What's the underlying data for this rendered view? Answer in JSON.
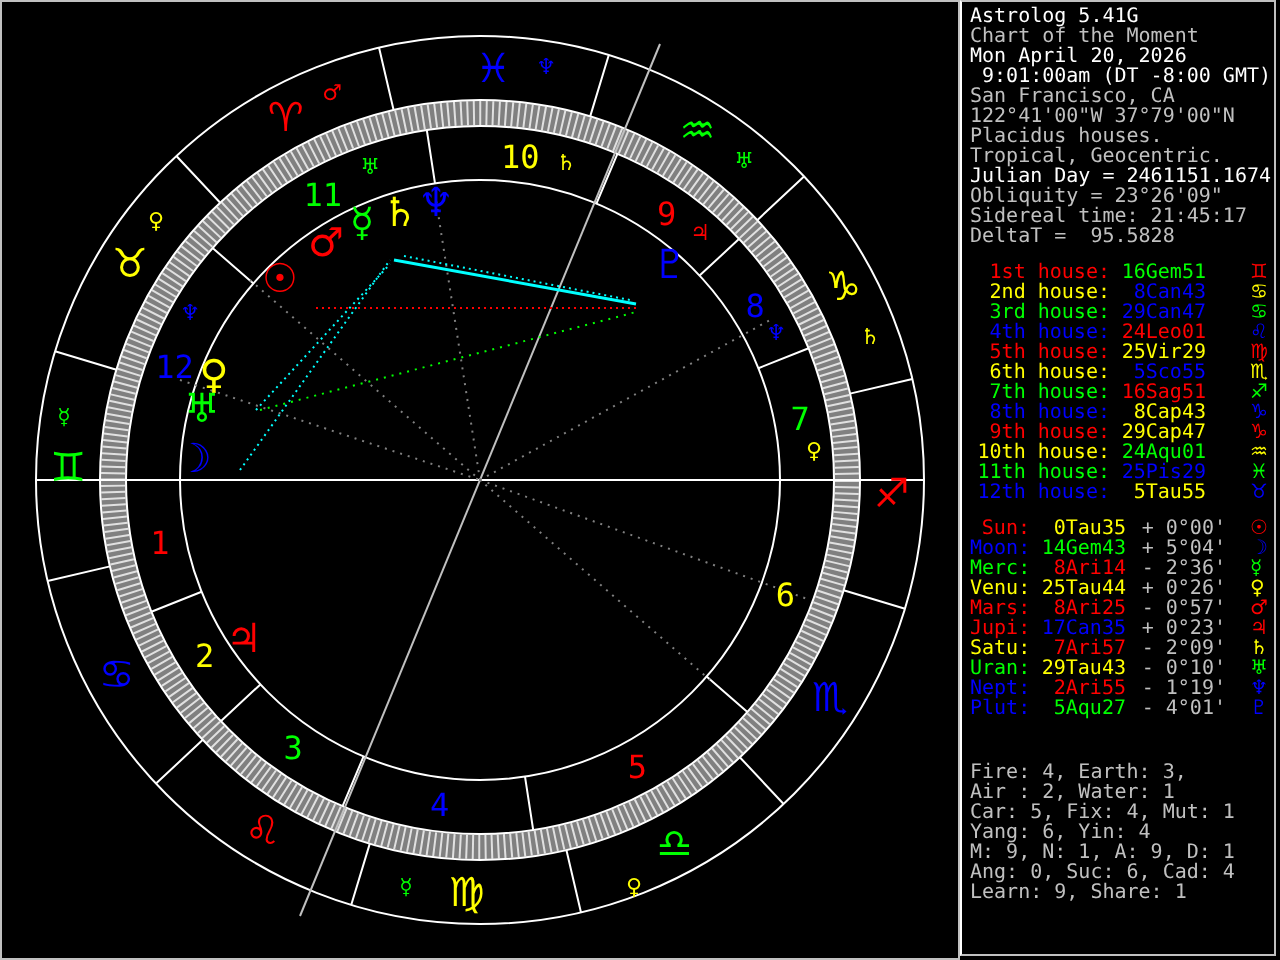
{
  "header": [
    {
      "text": "Astrolog 5.41G",
      "color": "#ffffff"
    },
    {
      "text": "Chart of the Moment",
      "color": "#c0c0c0"
    },
    {
      "text": "Mon April 20, 2026",
      "color": "#ffffff"
    },
    {
      "text": " 9:01:00am (DT -8:00 GMT)",
      "color": "#ffffff"
    },
    {
      "text": "San Francisco, CA",
      "color": "#c0c0c0"
    },
    {
      "text": "122°41'00\"W 37°79'00\"N",
      "color": "#c0c0c0"
    },
    {
      "text": "Placidus houses.",
      "color": "#c0c0c0"
    },
    {
      "text": "Tropical, Geocentric.",
      "color": "#c0c0c0"
    },
    {
      "text": "Julian Day = 2461151.1674",
      "color": "#ffffff"
    },
    {
      "text": "Obliquity = 23°26'09\"",
      "color": "#c0c0c0"
    },
    {
      "text": "Sidereal time: 21:45:17",
      "color": "#c0c0c0"
    },
    {
      "text": "DeltaT =  95.5828",
      "color": "#c0c0c0"
    }
  ],
  "houses": [
    {
      "label": "1st house:",
      "glyph": "♊",
      "color": "#ff0000",
      "position": {
        "text": "16Gem51",
        "color": "#00ff00"
      }
    },
    {
      "label": "2nd house:",
      "glyph": "♋",
      "color": "#ffff00",
      "position": {
        "text": "8Can43",
        "color": "#0000ff"
      }
    },
    {
      "label": "3rd house:",
      "glyph": "♋",
      "color": "#00ff00",
      "position": {
        "text": "29Can47",
        "color": "#0000ff"
      }
    },
    {
      "label": "4th house:",
      "glyph": "♌",
      "color": "#0000ff",
      "position": {
        "text": "24Leo01",
        "color": "#ff0000"
      }
    },
    {
      "label": "5th house:",
      "glyph": "♍",
      "color": "#ff0000",
      "position": {
        "text": "25Vir29",
        "color": "#ffff00"
      }
    },
    {
      "label": "6th house:",
      "glyph": "♏",
      "color": "#ffff00",
      "position": {
        "text": "5Sco55",
        "color": "#0000ff"
      }
    },
    {
      "label": "7th house:",
      "glyph": "♐",
      "color": "#00ff00",
      "position": {
        "text": "16Sag51",
        "color": "#ff0000"
      }
    },
    {
      "label": "8th house:",
      "glyph": "♑",
      "color": "#0000ff",
      "position": {
        "text": "8Cap43",
        "color": "#ffff00"
      }
    },
    {
      "label": "9th house:",
      "glyph": "♑",
      "color": "#ff0000",
      "position": {
        "text": "29Cap47",
        "color": "#ffff00"
      }
    },
    {
      "label": "10th house:",
      "glyph": "♒",
      "color": "#ffff00",
      "position": {
        "text": "24Aqu01",
        "color": "#00ff00"
      }
    },
    {
      "label": "11th house:",
      "glyph": "♓",
      "color": "#00ff00",
      "position": {
        "text": "25Pis29",
        "color": "#0000ff"
      }
    },
    {
      "label": "12th house:",
      "glyph": "♉",
      "color": "#0000ff",
      "position": {
        "text": "5Tau55",
        "color": "#ffff00"
      }
    }
  ],
  "planets": [
    {
      "name": "Sun:",
      "latitude": "+ 0°00'",
      "glyph": "☉",
      "color": "#ff0000",
      "position": {
        "text": "0Tau35",
        "color": "#ffff00"
      }
    },
    {
      "name": "Moon:",
      "latitude": "+ 5°04'",
      "glyph": "☽",
      "color": "#0000ff",
      "position": {
        "text": "14Gem43",
        "color": "#00ff00"
      }
    },
    {
      "name": "Merc:",
      "latitude": "- 2°36'",
      "glyph": "☿",
      "color": "#00ff00",
      "position": {
        "text": "8Ari14",
        "color": "#ff0000"
      }
    },
    {
      "name": "Venu:",
      "latitude": "+ 0°26'",
      "glyph": "♀",
      "color": "#ffff00",
      "position": {
        "text": "25Tau44",
        "color": "#ffff00"
      }
    },
    {
      "name": "Mars:",
      "latitude": "- 0°57'",
      "glyph": "♂",
      "color": "#ff0000",
      "position": {
        "text": "8Ari25",
        "color": "#ff0000"
      }
    },
    {
      "name": "Jupi:",
      "latitude": "+ 0°23'",
      "glyph": "♃",
      "color": "#ff0000",
      "position": {
        "text": "17Can35",
        "color": "#0000ff"
      }
    },
    {
      "name": "Satu:",
      "latitude": "- 2°09'",
      "glyph": "♄",
      "color": "#ffff00",
      "position": {
        "text": "7Ari57",
        "color": "#ff0000"
      }
    },
    {
      "name": "Uran:",
      "latitude": "- 0°10'",
      "glyph": "♅",
      "color": "#00ff00",
      "position": {
        "text": "29Tau43",
        "color": "#ffff00"
      }
    },
    {
      "name": "Nept:",
      "latitude": "- 1°19'",
      "glyph": "♆",
      "color": "#0000ff",
      "position": {
        "text": "2Ari55",
        "color": "#ff0000"
      }
    },
    {
      "name": "Plut:",
      "latitude": "- 4°01'",
      "glyph": "♇",
      "color": "#0000ff",
      "position": {
        "text": "5Aqu27",
        "color": "#00ff00"
      }
    }
  ],
  "stats": [
    "Fire: 4, Earth: 3,",
    "Air : 2, Water: 1",
    "Car: 5, Fix: 4, Mut: 1",
    "Yang: 6, Yin: 4",
    "M: 9, N: 1, A: 9, D: 1",
    "Ang: 0, Suc: 6, Cad: 4",
    "Learn: 9, Share: 1"
  ],
  "wheel": {
    "signs": [
      {
        "glyph": "♈",
        "color": "#ff0000"
      },
      {
        "glyph": "♉",
        "color": "#ffff00"
      },
      {
        "glyph": "♊",
        "color": "#00ff00"
      },
      {
        "glyph": "♋",
        "color": "#0000ff"
      },
      {
        "glyph": "♌",
        "color": "#ff0000"
      },
      {
        "glyph": "♍",
        "color": "#ffff00"
      },
      {
        "glyph": "♎",
        "color": "#00ff00"
      },
      {
        "glyph": "♏",
        "color": "#0000ff"
      },
      {
        "glyph": "♐",
        "color": "#ff0000"
      },
      {
        "glyph": "♑",
        "color": "#ffff00"
      },
      {
        "glyph": "♒",
        "color": "#00ff00"
      },
      {
        "glyph": "♓",
        "color": "#0000ff"
      }
    ],
    "house_numbers": [
      {
        "text": "1",
        "color": "#ff0000"
      },
      {
        "text": "2",
        "color": "#ffff00"
      },
      {
        "text": "3",
        "color": "#00ff00"
      },
      {
        "text": "4",
        "color": "#0000ff"
      },
      {
        "text": "5",
        "color": "#ff0000"
      },
      {
        "text": "6",
        "color": "#ffff00"
      },
      {
        "text": "7",
        "color": "#00ff00"
      },
      {
        "text": "8",
        "color": "#0000ff"
      },
      {
        "text": "9",
        "color": "#ff0000"
      },
      {
        "text": "10",
        "color": "#ffff00"
      },
      {
        "text": "11",
        "color": "#00ff00"
      },
      {
        "text": "12",
        "color": "#0000ff"
      }
    ],
    "planets": [
      {
        "glyph": "☉",
        "color": "#ff0000"
      },
      {
        "glyph": "☽",
        "color": "#0000ff"
      },
      {
        "glyph": "☿",
        "color": "#00ff00"
      },
      {
        "glyph": "♀",
        "color": "#ffff00"
      },
      {
        "glyph": "♂",
        "color": "#ff0000"
      },
      {
        "glyph": "♃",
        "color": "#ff0000"
      },
      {
        "glyph": "♄",
        "color": "#ffff00"
      },
      {
        "glyph": "♅",
        "color": "#00ff00"
      },
      {
        "glyph": "♆",
        "color": "#0000ff"
      },
      {
        "glyph": "♇",
        "color": "#0000ff"
      }
    ],
    "small_glyphs": [
      {
        "glyph": "♂",
        "color": "#ff0000"
      },
      {
        "glyph": "♀",
        "color": "#ffff00"
      },
      {
        "glyph": "☿",
        "color": "#00ff00"
      },
      {
        "glyph": "♆",
        "color": "#0000ff"
      },
      {
        "glyph": "♅",
        "color": "#00ff00"
      },
      {
        "glyph": "♄",
        "color": "#ffff00"
      },
      {
        "glyph": "☿",
        "color": "#00ff00"
      },
      {
        "glyph": "♀",
        "color": "#ffff00"
      },
      {
        "glyph": "♅",
        "color": "#00ff00"
      },
      {
        "glyph": "♆",
        "color": "#0000ff"
      },
      {
        "glyph": "♄",
        "color": "#ffff00"
      },
      {
        "glyph": "♃",
        "color": "#ff0000"
      },
      {
        "glyph": "♆",
        "color": "#0000ff"
      },
      {
        "glyph": "♀",
        "color": "#ffff00"
      }
    ]
  }
}
